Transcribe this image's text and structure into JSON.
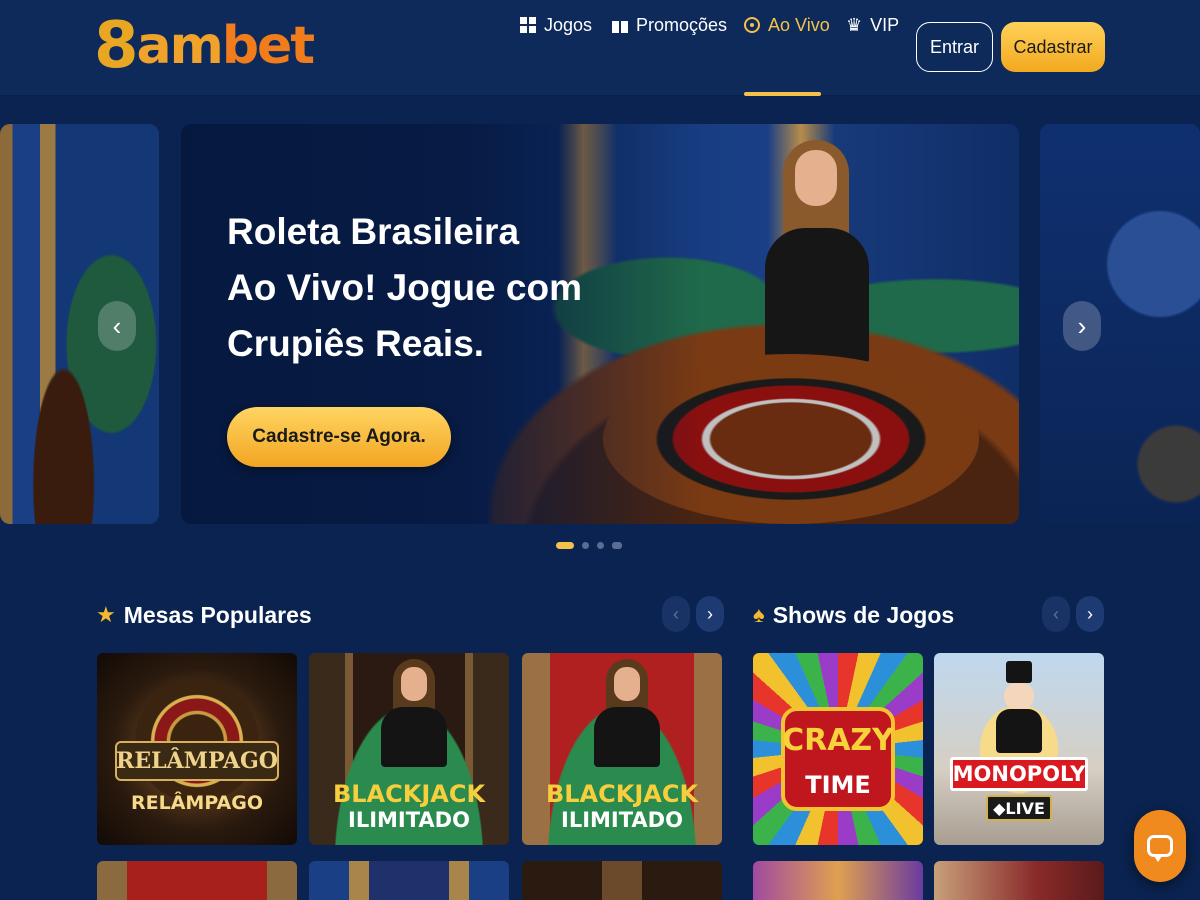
{
  "header": {
    "logo": {
      "first": "8",
      "middle": "am",
      "last": "bet"
    },
    "nav": [
      {
        "label": "Jogos",
        "icon": "grid-icon",
        "active": false
      },
      {
        "label": "Promoções",
        "icon": "gift-icon",
        "active": false
      },
      {
        "label": "Ao Vivo",
        "icon": "live-icon",
        "active": true
      },
      {
        "label": "VIP",
        "icon": "crown-icon",
        "active": false
      }
    ],
    "login_label": "Entrar",
    "register_label": "Cadastrar"
  },
  "hero": {
    "title_line1": "Roleta Brasileira",
    "title_line2": "Ao Vivo! Jogue com",
    "title_line3": "Crupiês Reais.",
    "cta_label": "Cadastre-se Agora.",
    "prev_icon": "chevron-left-icon",
    "next_icon": "chevron-right-icon",
    "slide_count": 4,
    "active_slide": 1
  },
  "sections": {
    "popular": {
      "title": "Mesas Populares",
      "icon": "star-icon",
      "cards": [
        {
          "banner": "RELÂMPAGO",
          "label": "RELÂMPAGO"
        },
        {
          "line1": "BLACKJACK",
          "line2": "ILIMITADO"
        },
        {
          "line1": "BLACKJACK",
          "line2": "ILIMITADO"
        }
      ]
    },
    "shows": {
      "title": "Shows de Jogos",
      "icon": "spade-icon",
      "cards": [
        {
          "line1": "CRAZY",
          "line2": "TIME"
        },
        {
          "line1": "MONOPOLY",
          "line2": "LIVE"
        }
      ]
    }
  },
  "chat": {
    "icon": "chat-icon"
  },
  "colors": {
    "background": "#0a2350",
    "header": "#0d2a5a",
    "accent": "#f5c14b",
    "cta": "#f2a521",
    "chat": "#f08a1e"
  }
}
